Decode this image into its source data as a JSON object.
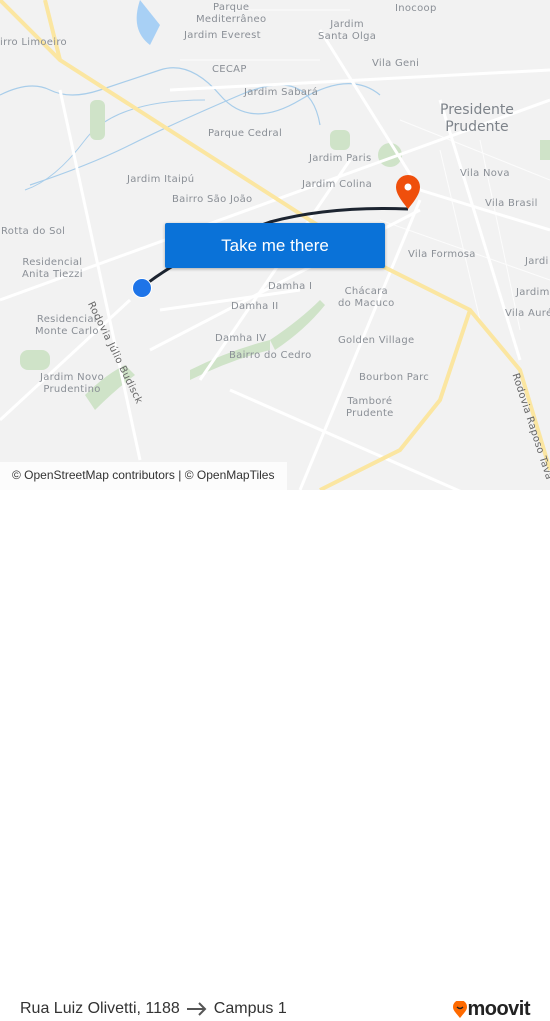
{
  "map": {
    "labels": {
      "parque_mediterraneo": "Parque\nMediterrâneo",
      "inocoop": "Inocoop",
      "jardim_everest": "Jardim Everest",
      "jardim_santa_olga": "Jardim\nSanta Olga",
      "bairro_limoeiro": "irro Limoeiro",
      "cecap": "CECAP",
      "vila_geni": "Vila Geni",
      "jardim_sabara": "Jardim Sabará",
      "presidente_prudente": "Presidente\nPrudente",
      "parque_cedral": "Parque Cedral",
      "jardim_paris": "Jardim Paris",
      "vila_nova": "Vila Nova",
      "jardim_itaipu": "Jardim Itaipú",
      "jardim_colina": "Jardim Colina",
      "bairro_sao_joao": "Bairro São João",
      "vila_brasil": "Vila Brasil",
      "rotta_do_sol": "Rotta do Sol",
      "vila_formosa": "Vila Formosa",
      "residencial_anita_tiezzi": "Residencial\nAnita Tiezzi",
      "damha_i": "Damha I",
      "chacara_do_macuco": "Chácara\ndo Macuco",
      "damha_ii": "Damha II",
      "residencial_monte_carlo": "Residencial\nMonte Carlo",
      "damha_iv": "Damha IV",
      "golden_village": "Golden Village",
      "bairro_do_cedro": "Bairro do Cedro",
      "jardim_novo_prudentino": "Jardim Novo\nPrudentino",
      "bourbon_parc": "Bourbon Parc",
      "tambore_prudente": "Tamboré\nPrudente",
      "vila_aurelio": "Vila Auréli",
      "jardim_r1": "Jardi",
      "jardim_r2": "Jardim",
      "road_julio": "Rodovia Júlio Budisck",
      "road_raposo": "Rodovia Raposo Tava"
    },
    "origin_color": "#1e74e8",
    "destination_color": "#ef4f0c",
    "destination_icon": "map-pin-icon"
  },
  "cta": {
    "label": "Take me there"
  },
  "attribution": "© OpenStreetMap contributors | © OpenMapTiles",
  "footer": {
    "origin": "Rua Luiz Olivetti, 1188",
    "arrow_icon": "arrow-right-icon",
    "destination": "Campus 1",
    "logo": "moovit",
    "brand_color": "#ff6a00"
  }
}
